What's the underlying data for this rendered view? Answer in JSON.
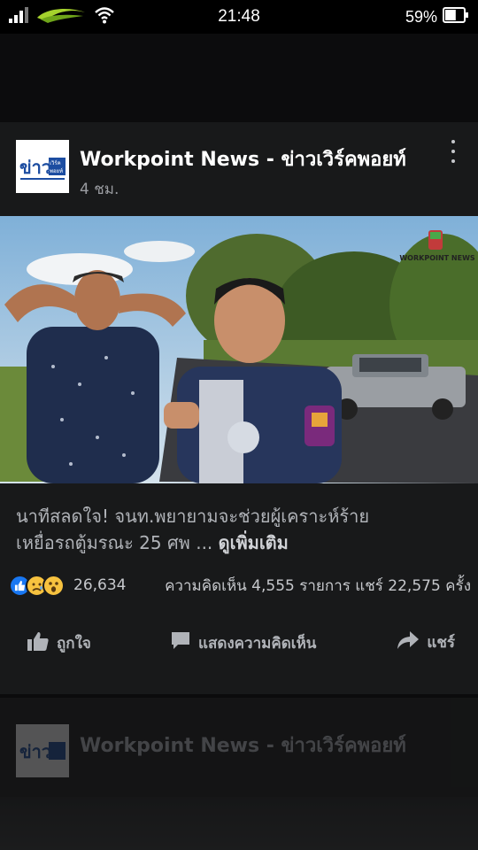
{
  "status_bar": {
    "time": "21:48",
    "battery_percent": "59%",
    "battery_level": 0.59,
    "icons": [
      "signal-icon",
      "carrier-logo-icon",
      "wifi-icon",
      "battery-icon"
    ]
  },
  "post": {
    "page_name": "Workpoint News - ข่าวเวิร์คพอยท์",
    "time": "4 ชม.",
    "avatar_logo_text": "ข่าว เวิร์ค พอยท์",
    "video_watermark": "WORKPOINT NEWS",
    "caption_line1": "นาทีสลดใจ! จนท.พยายามจะช่วยผู้เคราะห์ร้าย",
    "caption_line2": "เหยื่อรถตู้มรณะ 25 ศพ ...",
    "see_more": "ดูเพิ่มเติม",
    "reactions": [
      "like-reaction-icon",
      "sad-reaction-icon",
      "wow-reaction-icon"
    ],
    "reaction_count": "26,634",
    "comments_shares": "ความคิดเห็น 4,555 รายการ  แชร์ 22,575 ครั้ง",
    "actions": {
      "like": "ถูกใจ",
      "comment": "แสดงความคิดเห็น",
      "share": "แชร์"
    }
  },
  "next_post": {
    "page_name": "Workpoint News - ข่าวเวิร์คพอยท์"
  },
  "colors": {
    "background": "#121213",
    "card": "#18191a",
    "like_blue": "#1877f2",
    "reaction_yellow": "#f7c23f"
  }
}
